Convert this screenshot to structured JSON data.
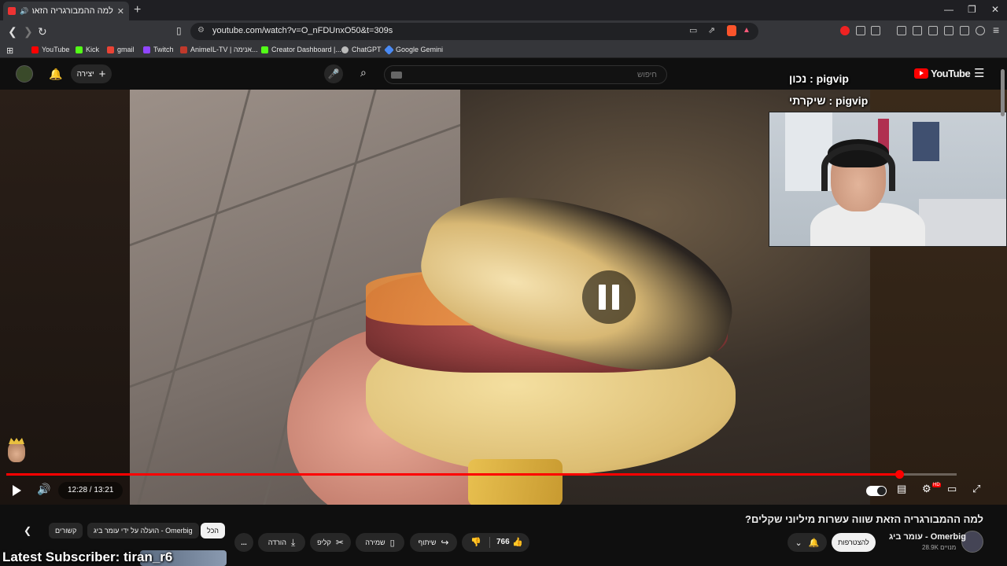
{
  "browser": {
    "tab_title": "למה ההמבורגריה הזאת שווה",
    "new_tab": "+",
    "url": "youtube.com/watch?v=O_nFDUnxO50&t=309s",
    "bookmarks": [
      {
        "label": "YouTube",
        "color": "#ff0000"
      },
      {
        "label": "Kick",
        "color": "#53fc18"
      },
      {
        "label": "gmail",
        "color": "#ea4335"
      },
      {
        "label": "Twitch",
        "color": "#9146ff"
      },
      {
        "label": "AnimeIL-TV | אנימה...",
        "color": "#c0392b"
      },
      {
        "label": "Creator Dashboard |...",
        "color": "#53fc18"
      },
      {
        "label": "ChatGPT",
        "color": "#bbbbbb"
      },
      {
        "label": "Google Gemini",
        "color": "#4a8af4"
      }
    ]
  },
  "header": {
    "create_label": "יצירה",
    "search_placeholder": "חיפוש",
    "logo_text": "YouTube"
  },
  "stream_overlay": {
    "line1": "נכון : pigvip",
    "line2": "שיקרתי : pigvip",
    "latest_subscriber": "Latest Subscriber: tiran_r6"
  },
  "player": {
    "time": "12:28 / 13:21",
    "progress": 0.9396,
    "state": "paused"
  },
  "video": {
    "title": "למה ההמבורגריה הזאת שווה עשרות מיליוני שקלים?",
    "channel_name": "עומר ביג - Omerbig",
    "subscribers": "28.9K מנויים",
    "join_label": "להצטרפות",
    "like_count": "766",
    "share_label": "שיתוף",
    "save_label": "שמירה",
    "clip_label": "קליפ",
    "download_label": "הורדה",
    "more_label": "..."
  },
  "chips": [
    {
      "label": "הכל",
      "active": true
    },
    {
      "label": "הועלה על ידי עומר ביג - Omerbig",
      "active": false
    },
    {
      "label": "קשורים",
      "active": false
    }
  ],
  "colors": {
    "accent": "#ff0000",
    "background": "#0f0f0f",
    "chip_bg": "#272727"
  }
}
